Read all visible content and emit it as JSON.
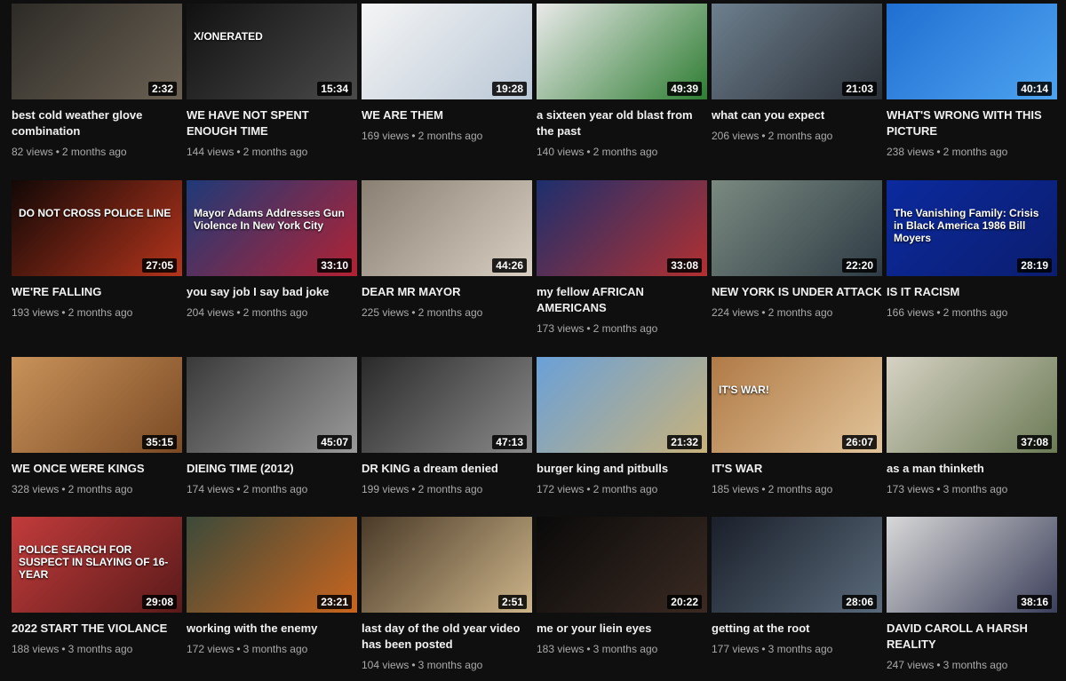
{
  "videos": [
    {
      "title": "best cold weather glove combination",
      "duration": "2:32",
      "views": "82 views",
      "age": "2 months ago",
      "bg": [
        "#2d2b27",
        "#6b6153"
      ]
    },
    {
      "title": "WE HAVE NOT SPENT ENOUGH TIME",
      "duration": "15:34",
      "views": "144 views",
      "age": "2 months ago",
      "bg": [
        "#111111",
        "#4a4a4a"
      ],
      "overlay": "X/ONERATED"
    },
    {
      "title": "WE ARE THEM",
      "duration": "19:28",
      "views": "169 views",
      "age": "2 months ago",
      "bg": [
        "#f5f5f5",
        "#b9c7d6"
      ]
    },
    {
      "title": "a sixteen year old blast from the past",
      "duration": "49:39",
      "views": "140 views",
      "age": "2 months ago",
      "bg": [
        "#e9e9e9",
        "#2e7d32"
      ]
    },
    {
      "title": "what can you expect",
      "duration": "21:03",
      "views": "206 views",
      "age": "2 months ago",
      "bg": [
        "#6d7f8e",
        "#2a2f36"
      ]
    },
    {
      "title": "WHAT'S WRONG WITH THIS PICTURE",
      "duration": "40:14",
      "views": "238 views",
      "age": "2 months ago",
      "bg": [
        "#1f6fd1",
        "#4ea3f0"
      ]
    },
    {
      "title": "WE'RE FALLING",
      "duration": "27:05",
      "views": "193 views",
      "age": "2 months ago",
      "bg": [
        "#120806",
        "#b3341c"
      ],
      "overlay": "DO NOT CROSS   POLICE LINE"
    },
    {
      "title": "you say job I say bad joke",
      "duration": "33:10",
      "views": "204 views",
      "age": "2 months ago",
      "bg": [
        "#1e3a78",
        "#b22234"
      ],
      "overlay": "Mayor Adams Addresses Gun Violence In New York City"
    },
    {
      "title": "DEAR MR MAYOR",
      "duration": "44:26",
      "views": "225 views",
      "age": "2 months ago",
      "bg": [
        "#8a7f73",
        "#d8cfc2"
      ]
    },
    {
      "title": "my fellow AFRICAN AMERICANS",
      "duration": "33:08",
      "views": "173 views",
      "age": "2 months ago",
      "bg": [
        "#1c2f6e",
        "#b23030"
      ]
    },
    {
      "title": "NEW YORK IS UNDER ATTACK",
      "duration": "22:20",
      "views": "224 views",
      "age": "2 months ago",
      "bg": [
        "#7a8a80",
        "#2e3b45"
      ]
    },
    {
      "title": "IS IT RACISM",
      "duration": "28:19",
      "views": "166 views",
      "age": "2 months ago",
      "bg": [
        "#0b2a9e",
        "#0b1d6e"
      ],
      "overlay": "The Vanishing Family: Crisis in Black America 1986 Bill Moyers"
    },
    {
      "title": "WE ONCE WERE KINGS",
      "duration": "35:15",
      "views": "328 views",
      "age": "2 months ago",
      "bg": [
        "#c9925a",
        "#7a4a24"
      ]
    },
    {
      "title": "DIEING TIME (2012)",
      "duration": "45:07",
      "views": "174 views",
      "age": "2 months ago",
      "bg": [
        "#3a3a3a",
        "#9a9a9a"
      ]
    },
    {
      "title": "DR KING a dream denied",
      "duration": "47:13",
      "views": "199 views",
      "age": "2 months ago",
      "bg": [
        "#2a2a2a",
        "#8a8a8a"
      ]
    },
    {
      "title": "burger king and pitbulls",
      "duration": "21:32",
      "views": "172 views",
      "age": "2 months ago",
      "bg": [
        "#6aa0d8",
        "#c8b27a"
      ]
    },
    {
      "title": "IT'S WAR",
      "duration": "26:07",
      "views": "185 views",
      "age": "2 months ago",
      "bg": [
        "#b07a46",
        "#e2c49a"
      ],
      "overlay": "IT'S WAR!"
    },
    {
      "title": "as a man thinketh",
      "duration": "37:08",
      "views": "173 views",
      "age": "3 months ago",
      "bg": [
        "#d6d2c4",
        "#6b7a55"
      ]
    },
    {
      "title": "2022 START THE VIOLANCE",
      "duration": "29:08",
      "views": "188 views",
      "age": "3 months ago",
      "bg": [
        "#c23b3b",
        "#5a1a1a"
      ],
      "overlay": "POLICE SEARCH FOR SUSPECT IN SLAYING OF 16-YEAR"
    },
    {
      "title": "working with the enemy",
      "duration": "23:21",
      "views": "172 views",
      "age": "3 months ago",
      "bg": [
        "#3c4a3a",
        "#c9651e"
      ]
    },
    {
      "title": "last day of the old year video has been posted",
      "duration": "2:51",
      "views": "104 views",
      "age": "3 months ago",
      "bg": [
        "#4a3a28",
        "#cdb58a"
      ]
    },
    {
      "title": "me or your liein eyes",
      "duration": "20:22",
      "views": "183 views",
      "age": "3 months ago",
      "bg": [
        "#0a0a0a",
        "#3a2a22"
      ]
    },
    {
      "title": "getting at the root",
      "duration": "28:06",
      "views": "177 views",
      "age": "3 months ago",
      "bg": [
        "#1a1f2a",
        "#5a6a7a"
      ]
    },
    {
      "title": "DAVID CAROLL A HARSH REALITY",
      "duration": "38:16",
      "views": "247 views",
      "age": "3 months ago",
      "bg": [
        "#d8d8d8",
        "#3b3f5a"
      ]
    }
  ]
}
